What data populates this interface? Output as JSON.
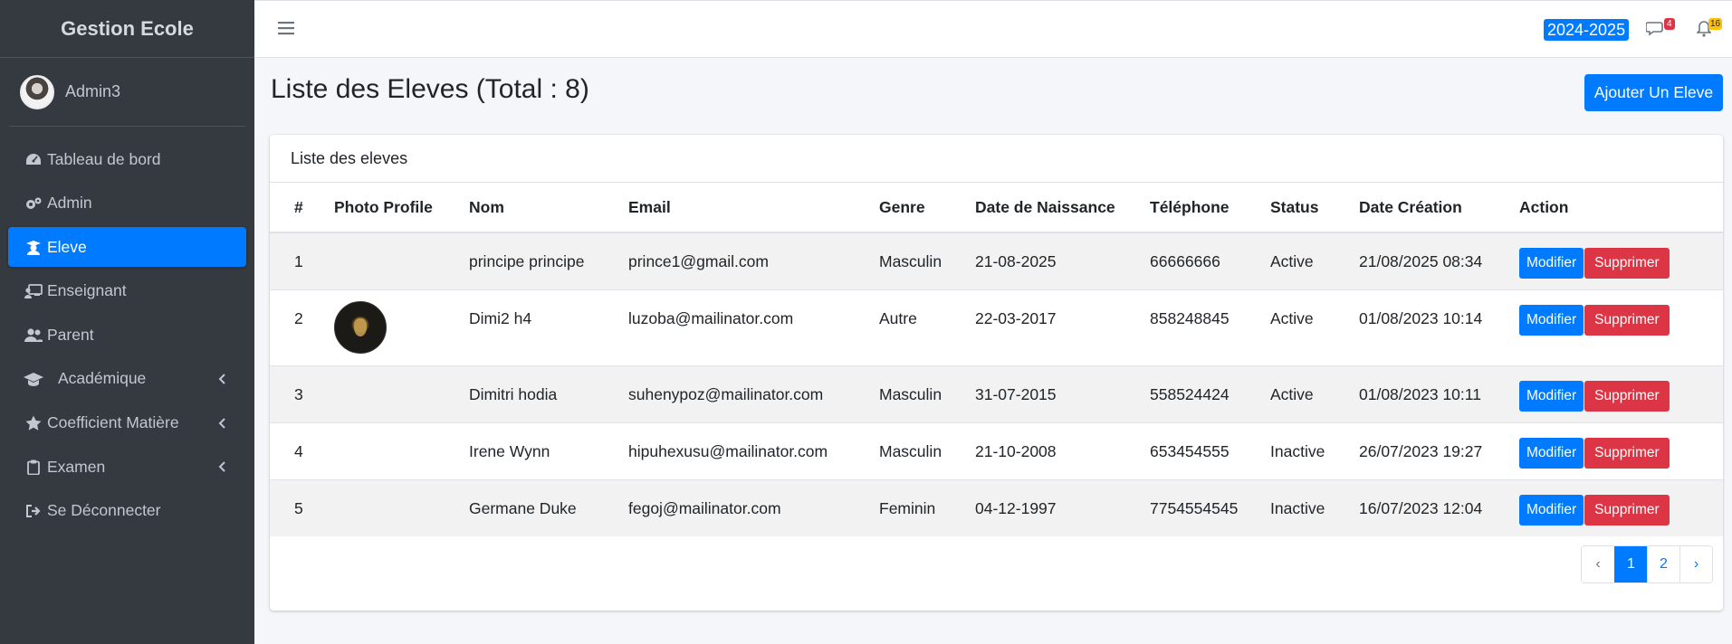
{
  "sidebar": {
    "brand": "Gestion Ecole",
    "user": "Admin3",
    "items": [
      {
        "label": "Tableau de bord",
        "icon": "dashboard-icon",
        "active": false,
        "chevron": false
      },
      {
        "label": "Admin",
        "icon": "cogs-icon",
        "active": false,
        "chevron": false
      },
      {
        "label": "Eleve",
        "icon": "student-icon",
        "active": true,
        "chevron": false
      },
      {
        "label": "Enseignant",
        "icon": "teacher-icon",
        "active": false,
        "chevron": false
      },
      {
        "label": "Parent",
        "icon": "users-icon",
        "active": false,
        "chevron": false
      },
      {
        "label": "Académique",
        "icon": "graduation-cap-icon",
        "active": false,
        "chevron": true
      },
      {
        "label": "Coefficient Matière",
        "icon": "star-icon",
        "active": false,
        "chevron": true
      },
      {
        "label": "Examen",
        "icon": "clipboard-icon",
        "active": false,
        "chevron": true
      },
      {
        "label": "Se Déconnecter",
        "icon": "sign-out-icon",
        "active": false,
        "chevron": false
      }
    ]
  },
  "topbar": {
    "year": "2024-2025",
    "messages_count": "4",
    "notifications_count": "16"
  },
  "page": {
    "title": "Liste des Eleves (Total : 8)",
    "add_button": "Ajouter Un Eleve"
  },
  "card": {
    "header": "Liste des eleves"
  },
  "table": {
    "columns": [
      "#",
      "Photo Profile",
      "Nom",
      "Email",
      "Genre",
      "Date de Naissance",
      "Téléphone",
      "Status",
      "Date Création",
      "Action"
    ],
    "rows": [
      {
        "num": "1",
        "photo": false,
        "nom": "principe principe",
        "email": "prince1@gmail.com",
        "genre": "Masculin",
        "naissance": "21-08-2025",
        "telephone": "66666666",
        "status": "Active",
        "creation": "21/08/2025 08:34"
      },
      {
        "num": "2",
        "photo": true,
        "nom": "Dimi2 h4",
        "email": "luzoba@mailinator.com",
        "genre": "Autre",
        "naissance": "22-03-2017",
        "telephone": "858248845",
        "status": "Active",
        "creation": "01/08/2023 10:14"
      },
      {
        "num": "3",
        "photo": false,
        "nom": "Dimitri hodia",
        "email": "suhenypoz@mailinator.com",
        "genre": "Masculin",
        "naissance": "31-07-2015",
        "telephone": "558524424",
        "status": "Active",
        "creation": "01/08/2023 10:11"
      },
      {
        "num": "4",
        "photo": false,
        "nom": "Irene Wynn",
        "email": "hipuhexusu@mailinator.com",
        "genre": "Masculin",
        "naissance": "21-10-2008",
        "telephone": "653454555",
        "status": "Inactive",
        "creation": "26/07/2023 19:27"
      },
      {
        "num": "5",
        "photo": false,
        "nom": "Germane Duke",
        "email": "fegoj@mailinator.com",
        "genre": "Feminin",
        "naissance": "04-12-1997",
        "telephone": "7754554545",
        "status": "Inactive",
        "creation": "16/07/2023 12:04"
      }
    ],
    "modify_label": "Modifier",
    "delete_label": "Supprimer"
  },
  "pagination": {
    "prev": "‹",
    "pages": [
      "1",
      "2"
    ],
    "current": "1",
    "next": "›"
  },
  "colors": {
    "sidebar_bg": "#343a40",
    "primary": "#007bff",
    "danger": "#dc3545",
    "warning": "#ffc107"
  }
}
